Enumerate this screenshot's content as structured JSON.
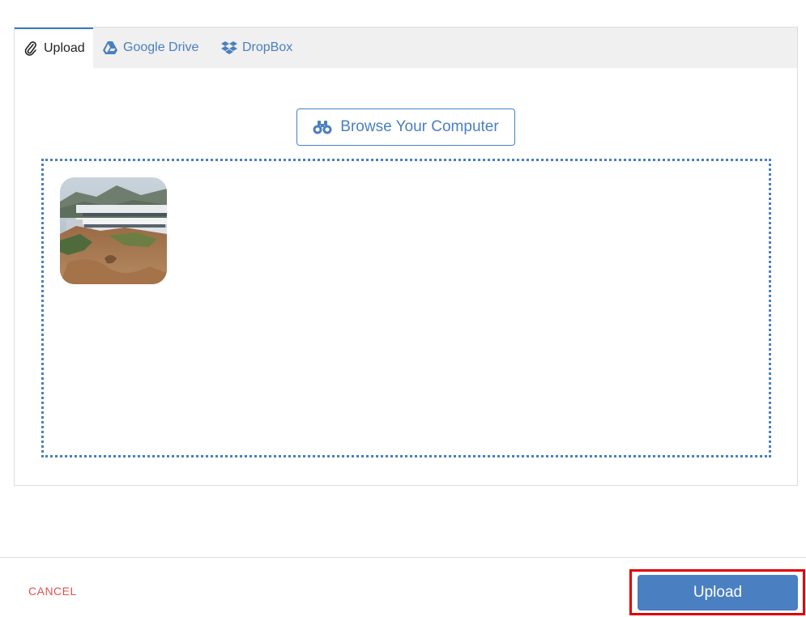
{
  "tabs": {
    "upload": {
      "label": "Upload",
      "icon": "paperclip-icon"
    },
    "google_drive": {
      "label": "Google Drive",
      "icon": "google-drive-icon"
    },
    "dropbox": {
      "label": "DropBox",
      "icon": "dropbox-icon"
    }
  },
  "browse": {
    "label": "Browse Your Computer",
    "icon": "binoculars-icon"
  },
  "footer": {
    "cancel_label": "CANCEL",
    "upload_label": "Upload"
  },
  "colors": {
    "accent": "#4a80c2",
    "cancel": "#e05050",
    "highlight": "#e00000"
  }
}
